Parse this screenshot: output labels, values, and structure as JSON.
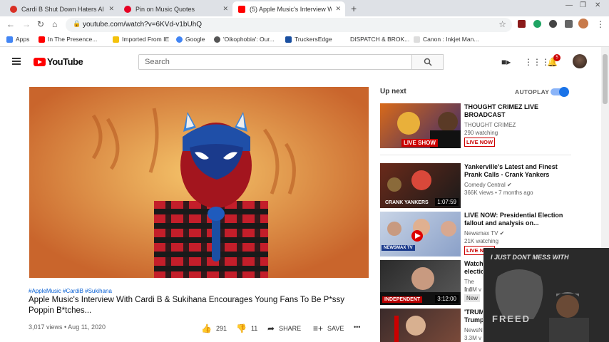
{
  "browser": {
    "tabs": [
      {
        "label": "Cardi B Shut Down Haters About",
        "favicon_color": "#d93025"
      },
      {
        "label": "Pin on Music Quotes",
        "favicon_color": "#e60023"
      },
      {
        "label": "(5) Apple Music's Interview W",
        "favicon_color": "#ff0000"
      }
    ],
    "new_tab": "+",
    "url": "youtube.com/watch?v=6KVd-v1bUhQ",
    "bookmarks": [
      {
        "label": "Apps",
        "color": "#4285f4"
      },
      {
        "label": "In The Presence...",
        "color": "#ff0000"
      },
      {
        "label": "Imported From IE",
        "color": "#f4c20d"
      },
      {
        "label": "Google",
        "color": "#4285f4"
      },
      {
        "label": "'Oikophobia': Our...",
        "color": "#555555"
      },
      {
        "label": "TruckersEdge",
        "color": "#1a4fa0"
      },
      {
        "label": "DISPATCH & BROK...",
        "color": "#ffffff"
      },
      {
        "label": "Canon : Inkjet Man...",
        "color": "#d0d0d0"
      }
    ]
  },
  "youtube": {
    "logo_text": "YouTube",
    "search_placeholder": "Search",
    "notification_count": "5"
  },
  "video": {
    "hashtags": "#AppleMusic #CardiB #Sukihana",
    "title": "Apple Music's Interview With Cardi B & Sukihana Encourages Young Fans To Be P*ssy Poppin B*tches...",
    "views_date": "3,017 views • Aug 11, 2020",
    "likes": "291",
    "dislikes": "11",
    "share_label": "SHARE",
    "save_label": "SAVE",
    "more": "•••"
  },
  "sidebar": {
    "up_next": "Up next",
    "autoplay": "AUTOPLAY",
    "items": [
      {
        "title": "THOUGHT CRIMEZ LIVE\nBROADCAST",
        "channel": "THOUGHT CRIMEZ",
        "stats": "290 watching",
        "badge": "LIVE NOW",
        "thumb_text": "LIVE SHOW"
      },
      {
        "title": "Yankerville's Latest and Finest\nPrank Calls - Crank Yankers",
        "channel": "Comedy Central ✔",
        "stats": "366K views • 7 months ago",
        "duration": "1:07:59",
        "thumb_text": "CRANK YANKERS"
      },
      {
        "title": "LIVE NOW: Presidential Election\nfallout and analysis on...",
        "channel": "Newsmax TV ✔",
        "stats": "21K watching",
        "badge": "LIVE NOW",
        "thumb_text": "NEWSMAX TV"
      },
      {
        "title": "Watch\nelectio",
        "channel": "The Ind",
        "stats": "1.1M v",
        "badge": "New",
        "duration": "3:12:00",
        "thumb_text": "INDEPENDENT"
      },
      {
        "title": "'TRUM\nTrump",
        "channel": "NewsN",
        "stats": "3.3M v",
        "thumb_text": ""
      }
    ]
  },
  "webcam": {
    "banner_text": "I JUST DONT MESS WITH",
    "lower_text": "FREED"
  }
}
